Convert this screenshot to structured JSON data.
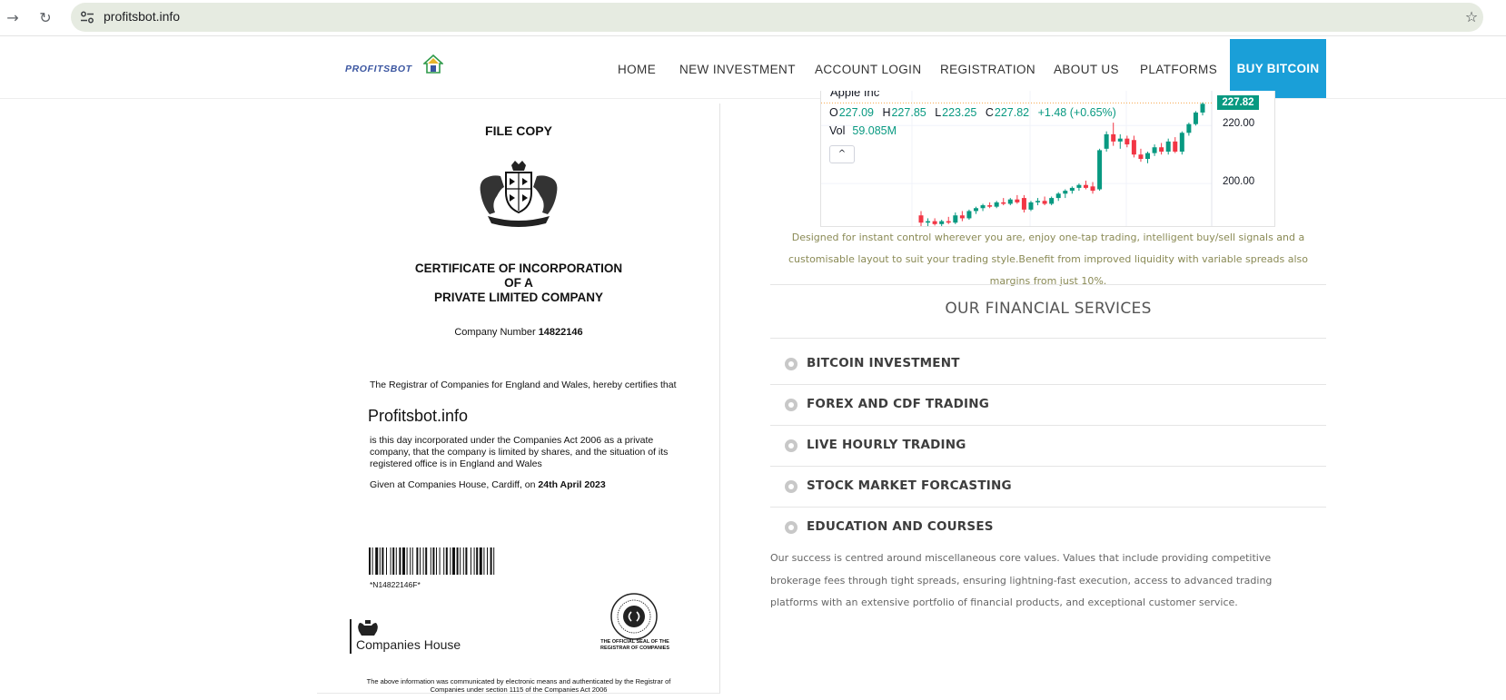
{
  "browser": {
    "url": "profitsbot.info",
    "icons": [
      "forward-icon",
      "reload-icon",
      "site-settings-icon",
      "bookmark-star-icon"
    ]
  },
  "site": {
    "logo_text": "PROFITSBOT",
    "nav": [
      {
        "label": "HOME"
      },
      {
        "label": "NEW INVESTMENT"
      },
      {
        "label": "ACCOUNT LOGIN"
      },
      {
        "label": "REGISTRATION"
      },
      {
        "label": "ABOUT US"
      },
      {
        "label": "PLATFORMS"
      }
    ],
    "buy_button": "BUY BITCOIN",
    "colors": {
      "accent": "#1a9fd8",
      "chart_up": "#089981",
      "chart_down": "#f23645"
    }
  },
  "certificate": {
    "file_copy": "FILE COPY",
    "title_line1": "CERTIFICATE OF INCORPORATION",
    "title_line2": "OF A",
    "title_line3": "PRIVATE LIMITED COMPANY",
    "company_number_label": "Company Number",
    "company_number": "14822146",
    "para1": "The Registrar of Companies for England and Wales, hereby certifies that",
    "company_name": "Profitsbot.info",
    "para2": "is this day incorporated under the Companies Act 2006 as a private company, that the company is limited by shares, and the situation of its registered office is in England and Wales",
    "given_prefix": "Given at Companies House, Cardiff, on",
    "given_date": "24th April 2023",
    "barcode_text": "*N14822146F*",
    "companies_house": "Companies House",
    "seal_caption": "THE OFFICIAL SEAL OF THE REGISTRAR OF COMPANIES",
    "footer": "The above information was communicated by electronic means and authenticated by the Registrar of Companies under section 1115 of the Companies Act 2006"
  },
  "chart": {
    "instrument": "Apple Inc",
    "ohlc": {
      "o": "227.09",
      "h": "227.85",
      "l": "223.25",
      "c": "227.82",
      "change": "+1.48 (+0.65%)"
    },
    "volume_label": "Vol",
    "volume": "59.085M",
    "last_price": "227.82",
    "collapse_label": "^"
  },
  "chart_data": {
    "type": "candlestick",
    "ylim": [
      185,
      232
    ],
    "y_ticks": [
      "220.00",
      "200.00"
    ],
    "candles": [
      {
        "o": 189,
        "h": 190.5,
        "l": 185,
        "c": 186.5
      },
      {
        "o": 186.5,
        "h": 188,
        "l": 185,
        "c": 187
      },
      {
        "o": 187,
        "h": 188,
        "l": 185.5,
        "c": 186
      },
      {
        "o": 186,
        "h": 187.5,
        "l": 185,
        "c": 187
      },
      {
        "o": 187,
        "h": 188.5,
        "l": 186,
        "c": 186.5
      },
      {
        "o": 186.5,
        "h": 190,
        "l": 186,
        "c": 189
      },
      {
        "o": 189,
        "h": 190.5,
        "l": 187,
        "c": 188
      },
      {
        "o": 188,
        "h": 191,
        "l": 187.5,
        "c": 190.5
      },
      {
        "o": 190.5,
        "h": 192,
        "l": 189.5,
        "c": 191.5
      },
      {
        "o": 191.5,
        "h": 193,
        "l": 190.5,
        "c": 192.5
      },
      {
        "o": 192.5,
        "h": 193.5,
        "l": 191.5,
        "c": 192
      },
      {
        "o": 192,
        "h": 194,
        "l": 191.5,
        "c": 193.5
      },
      {
        "o": 193.5,
        "h": 195,
        "l": 192.5,
        "c": 193
      },
      {
        "o": 193,
        "h": 195,
        "l": 192.5,
        "c": 194.5
      },
      {
        "o": 194.5,
        "h": 196,
        "l": 193,
        "c": 193.5
      },
      {
        "o": 195,
        "h": 196,
        "l": 190,
        "c": 191
      },
      {
        "o": 191,
        "h": 194,
        "l": 190.5,
        "c": 193.5
      },
      {
        "o": 193.5,
        "h": 195,
        "l": 192.5,
        "c": 194
      },
      {
        "o": 194,
        "h": 195.5,
        "l": 192.5,
        "c": 193
      },
      {
        "o": 193,
        "h": 195.5,
        "l": 192.5,
        "c": 195
      },
      {
        "o": 195,
        "h": 197,
        "l": 194,
        "c": 196.5
      },
      {
        "o": 196.5,
        "h": 198,
        "l": 195,
        "c": 197.5
      },
      {
        "o": 197.5,
        "h": 199,
        "l": 196.5,
        "c": 198.5
      },
      {
        "o": 198.5,
        "h": 200,
        "l": 197.5,
        "c": 199.5
      },
      {
        "o": 199.5,
        "h": 201,
        "l": 198,
        "c": 198.5
      },
      {
        "o": 199,
        "h": 200.5,
        "l": 196.5,
        "c": 197.5
      },
      {
        "o": 198,
        "h": 212,
        "l": 197.5,
        "c": 211.5
      },
      {
        "o": 212,
        "h": 218,
        "l": 211,
        "c": 217
      },
      {
        "o": 217,
        "h": 221,
        "l": 213,
        "c": 214.5
      },
      {
        "o": 214.5,
        "h": 217,
        "l": 212,
        "c": 215.5
      },
      {
        "o": 215.5,
        "h": 216.5,
        "l": 212.5,
        "c": 213.5
      },
      {
        "o": 215,
        "h": 216.5,
        "l": 209,
        "c": 210
      },
      {
        "o": 210,
        "h": 212,
        "l": 207.5,
        "c": 208.5
      },
      {
        "o": 208.5,
        "h": 211,
        "l": 207,
        "c": 210.5
      },
      {
        "o": 210.5,
        "h": 213.5,
        "l": 209.5,
        "c": 212.5
      },
      {
        "o": 212.5,
        "h": 214,
        "l": 210,
        "c": 211
      },
      {
        "o": 211,
        "h": 215.5,
        "l": 210,
        "c": 214.5
      },
      {
        "o": 214.5,
        "h": 216,
        "l": 210.5,
        "c": 211
      },
      {
        "o": 211,
        "h": 218,
        "l": 210,
        "c": 217.5
      },
      {
        "o": 217.5,
        "h": 221,
        "l": 216.5,
        "c": 220.5
      },
      {
        "o": 220.5,
        "h": 225,
        "l": 220,
        "c": 224.5
      },
      {
        "o": 224.5,
        "h": 228,
        "l": 223.5,
        "c": 227.5
      }
    ]
  },
  "main": {
    "designed_text": "Designed for instant control wherever you are, enjoy one-tap trading, intelligent buy/sell signals and a customisable layout to suit your trading style.Benefit from improved liquidity with variable spreads also margins from just 10%.",
    "services_title": "OUR FINANCIAL SERVICES",
    "services": [
      {
        "label": "BITCOIN INVESTMENT"
      },
      {
        "label": "FOREX AND CDF TRADING"
      },
      {
        "label": "LIVE HOURLY TRADING"
      },
      {
        "label": "STOCK MARKET FORCASTING"
      },
      {
        "label": "EDUCATION AND COURSES"
      }
    ],
    "core_values": "Our success is centred around miscellaneous core values. Values that include providing competitive brokerage fees through tight spreads, ensuring lightning-fast execution, access to advanced trading platforms with an extensive portfolio of financial products, and exceptional customer service."
  }
}
